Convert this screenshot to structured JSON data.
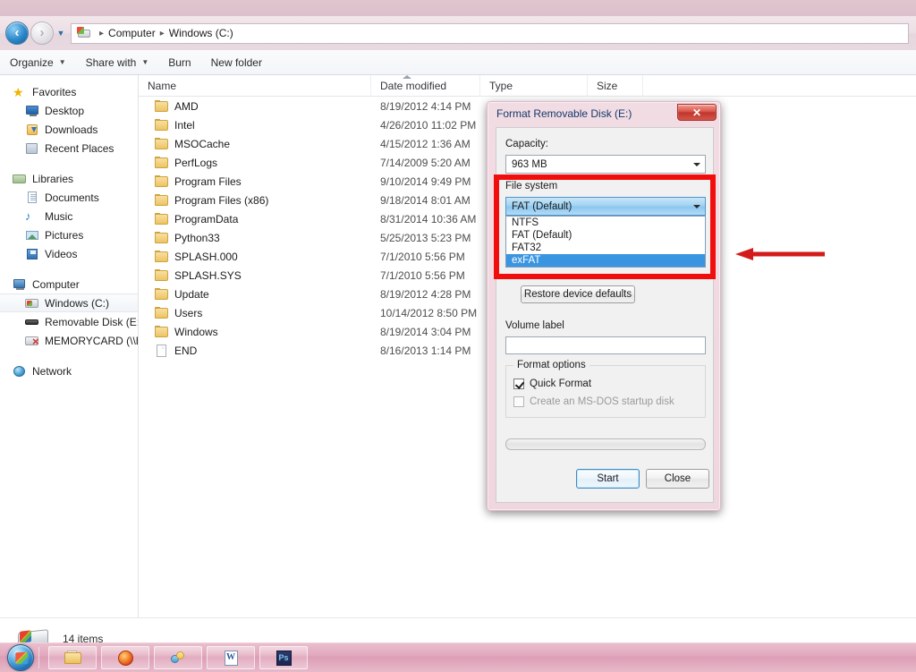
{
  "window": {
    "addressbar": {
      "back_tooltip": "Back",
      "forward_tooltip": "Forward",
      "crumbs": [
        "Computer",
        "Windows (C:)"
      ],
      "separator": "▸"
    },
    "toolbar": {
      "items": [
        {
          "label": "Organize",
          "caret": true
        },
        {
          "label": "Share with",
          "caret": true
        },
        {
          "label": "Burn",
          "caret": false
        },
        {
          "label": "New folder",
          "caret": false
        }
      ]
    },
    "statusbar": {
      "text": "14 items"
    }
  },
  "navpane": {
    "groups": [
      {
        "header": {
          "label": "Favorites",
          "icon": "star-icon"
        },
        "items": [
          {
            "label": "Desktop",
            "icon": "desktop-icon"
          },
          {
            "label": "Downloads",
            "icon": "downloads-icon"
          },
          {
            "label": "Recent Places",
            "icon": "recent-places-icon"
          }
        ]
      },
      {
        "header": {
          "label": "Libraries",
          "icon": "libraries-icon"
        },
        "items": [
          {
            "label": "Documents",
            "icon": "documents-icon"
          },
          {
            "label": "Music",
            "icon": "music-icon"
          },
          {
            "label": "Pictures",
            "icon": "pictures-icon"
          },
          {
            "label": "Videos",
            "icon": "videos-icon"
          }
        ]
      },
      {
        "header": {
          "label": "Computer",
          "icon": "computer-icon"
        },
        "items": [
          {
            "label": "Windows (C:)",
            "icon": "hard-drive-icon",
            "selected": true
          },
          {
            "label": "Removable Disk (E:)",
            "icon": "removable-disk-icon"
          },
          {
            "label": "MEMORYCARD (\\\\E",
            "icon": "network-drive-disconnected-icon"
          }
        ]
      },
      {
        "header": {
          "label": "Network",
          "icon": "network-icon"
        },
        "items": []
      }
    ]
  },
  "filelist": {
    "columns": [
      "Name",
      "Date modified",
      "Type",
      "Size"
    ],
    "rows": [
      {
        "name": "AMD",
        "date": "8/19/2012 4:14 PM",
        "type": "",
        "size": "",
        "icon": "folder-icon"
      },
      {
        "name": "Intel",
        "date": "4/26/2010 11:02 PM",
        "type": "",
        "size": "",
        "icon": "folder-icon"
      },
      {
        "name": "MSOCache",
        "date": "4/15/2012 1:36 AM",
        "type": "",
        "size": "",
        "icon": "folder-icon"
      },
      {
        "name": "PerfLogs",
        "date": "7/14/2009 5:20 AM",
        "type": "",
        "size": "",
        "icon": "folder-icon"
      },
      {
        "name": "Program Files",
        "date": "9/10/2014 9:49 PM",
        "type": "",
        "size": "",
        "icon": "folder-icon"
      },
      {
        "name": "Program Files (x86)",
        "date": "9/18/2014 8:01 AM",
        "type": "",
        "size": "",
        "icon": "folder-icon"
      },
      {
        "name": "ProgramData",
        "date": "8/31/2014 10:36 AM",
        "type": "",
        "size": "",
        "icon": "folder-icon"
      },
      {
        "name": "Python33",
        "date": "5/25/2013 5:23 PM",
        "type": "",
        "size": "",
        "icon": "folder-icon"
      },
      {
        "name": "SPLASH.000",
        "date": "7/1/2010 5:56 PM",
        "type": "",
        "size": "",
        "icon": "folder-icon"
      },
      {
        "name": "SPLASH.SYS",
        "date": "7/1/2010 5:56 PM",
        "type": "",
        "size": "",
        "icon": "folder-icon"
      },
      {
        "name": "Update",
        "date": "8/19/2012 4:28 PM",
        "type": "",
        "size": "",
        "icon": "folder-icon"
      },
      {
        "name": "Users",
        "date": "10/14/2012 8:50 PM",
        "type": "",
        "size": "",
        "icon": "folder-icon"
      },
      {
        "name": "Windows",
        "date": "8/19/2014 3:04 PM",
        "type": "",
        "size": "",
        "icon": "folder-icon"
      },
      {
        "name": "END",
        "date": "8/16/2013 1:14 PM",
        "type": "",
        "size": "",
        "icon": "file-icon"
      }
    ]
  },
  "dialog": {
    "title": "Format Removable Disk (E:)",
    "close_label": "✕",
    "capacity": {
      "label": "Capacity:",
      "value": "963 MB"
    },
    "filesystem": {
      "label": "File system",
      "value": "FAT (Default)",
      "options": [
        "NTFS",
        "FAT (Default)",
        "FAT32",
        "exFAT"
      ],
      "highlighted_option": "exFAT"
    },
    "restore_button": "Restore device defaults",
    "volume_label": {
      "label": "Volume label",
      "value": "",
      "placeholder": ""
    },
    "format_options": {
      "title": "Format options",
      "quick_format": {
        "label": "Quick Format",
        "checked": true,
        "disabled": false
      },
      "msdos_startup": {
        "label": "Create an MS-DOS startup disk",
        "checked": false,
        "disabled": true
      }
    },
    "progress_percent": 0,
    "buttons": {
      "start": "Start",
      "close": "Close"
    }
  },
  "annotations": {
    "highlight_color": "#f20d0d",
    "arrow_color": "#d31b1b",
    "highlight_target": "file-system-dropdown",
    "arrow_direction": "left"
  },
  "taskbar": {
    "start_label": "Start",
    "buttons": [
      {
        "name": "windows-explorer",
        "icon": "explorer-icon"
      },
      {
        "name": "firefox",
        "icon": "firefox-icon"
      },
      {
        "name": "paint",
        "icon": "paint-icon"
      },
      {
        "name": "word",
        "icon": "word-icon"
      },
      {
        "name": "photoshop",
        "icon": "photoshop-icon"
      }
    ]
  }
}
